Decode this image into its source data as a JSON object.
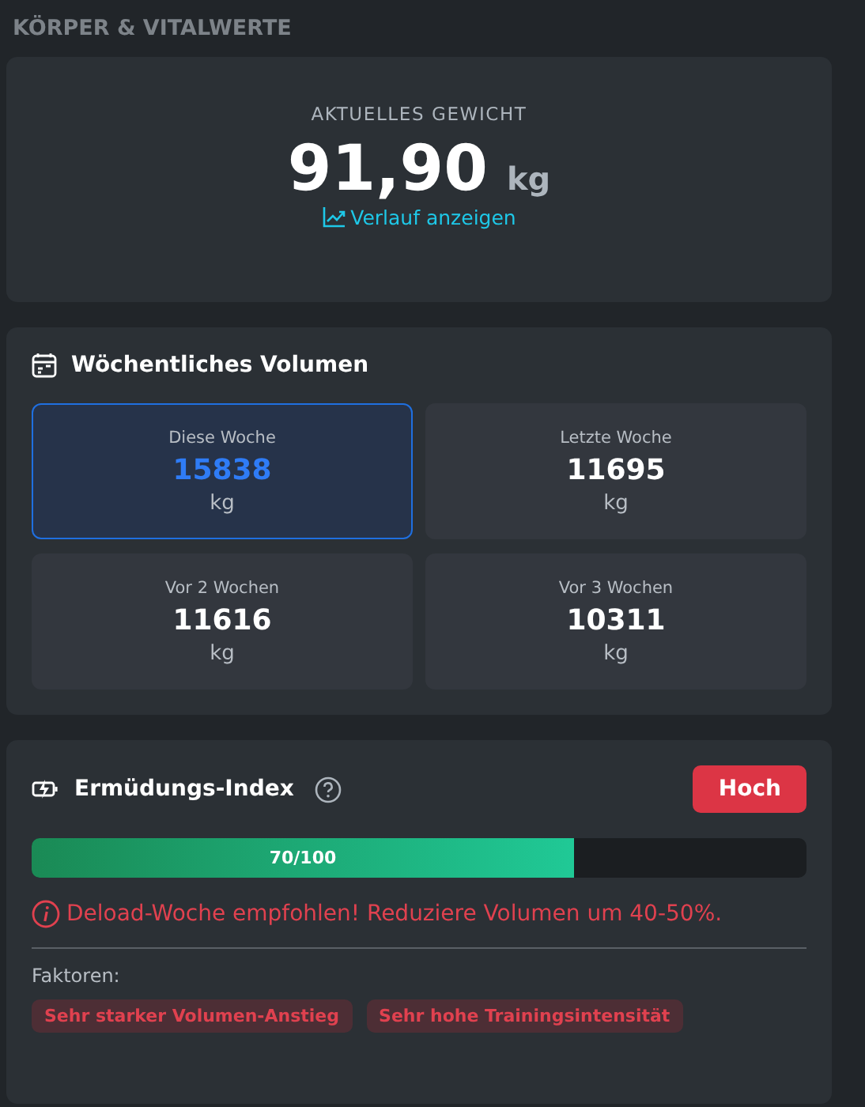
{
  "section_title": "KÖRPER & VITALWERTE",
  "weight": {
    "label": "AKTUELLES GEWICHT",
    "value": "91,90",
    "unit": "kg",
    "link": "Verlauf anzeigen"
  },
  "volume": {
    "title": "Wöchentliches Volumen",
    "weeks": [
      {
        "label": "Diese Woche",
        "value": "15838",
        "unit": "kg",
        "selected": true
      },
      {
        "label": "Letzte Woche",
        "value": "11695",
        "unit": "kg",
        "selected": false
      },
      {
        "label": "Vor 2 Wochen",
        "value": "11616",
        "unit": "kg",
        "selected": false
      },
      {
        "label": "Vor 3 Wochen",
        "value": "10311",
        "unit": "kg",
        "selected": false
      }
    ]
  },
  "fatigue": {
    "title": "Ermüdungs-Index",
    "badge": "Hoch",
    "level": 0.7,
    "reading": "70/100",
    "warning": "Deload-Woche empfohlen! Reduziere Volumen um 40-50%.",
    "factors_label": "Faktoren:",
    "factors": [
      "Sehr starker Volumen-Anstieg",
      "Sehr hohe Trainingsintensität"
    ]
  }
}
